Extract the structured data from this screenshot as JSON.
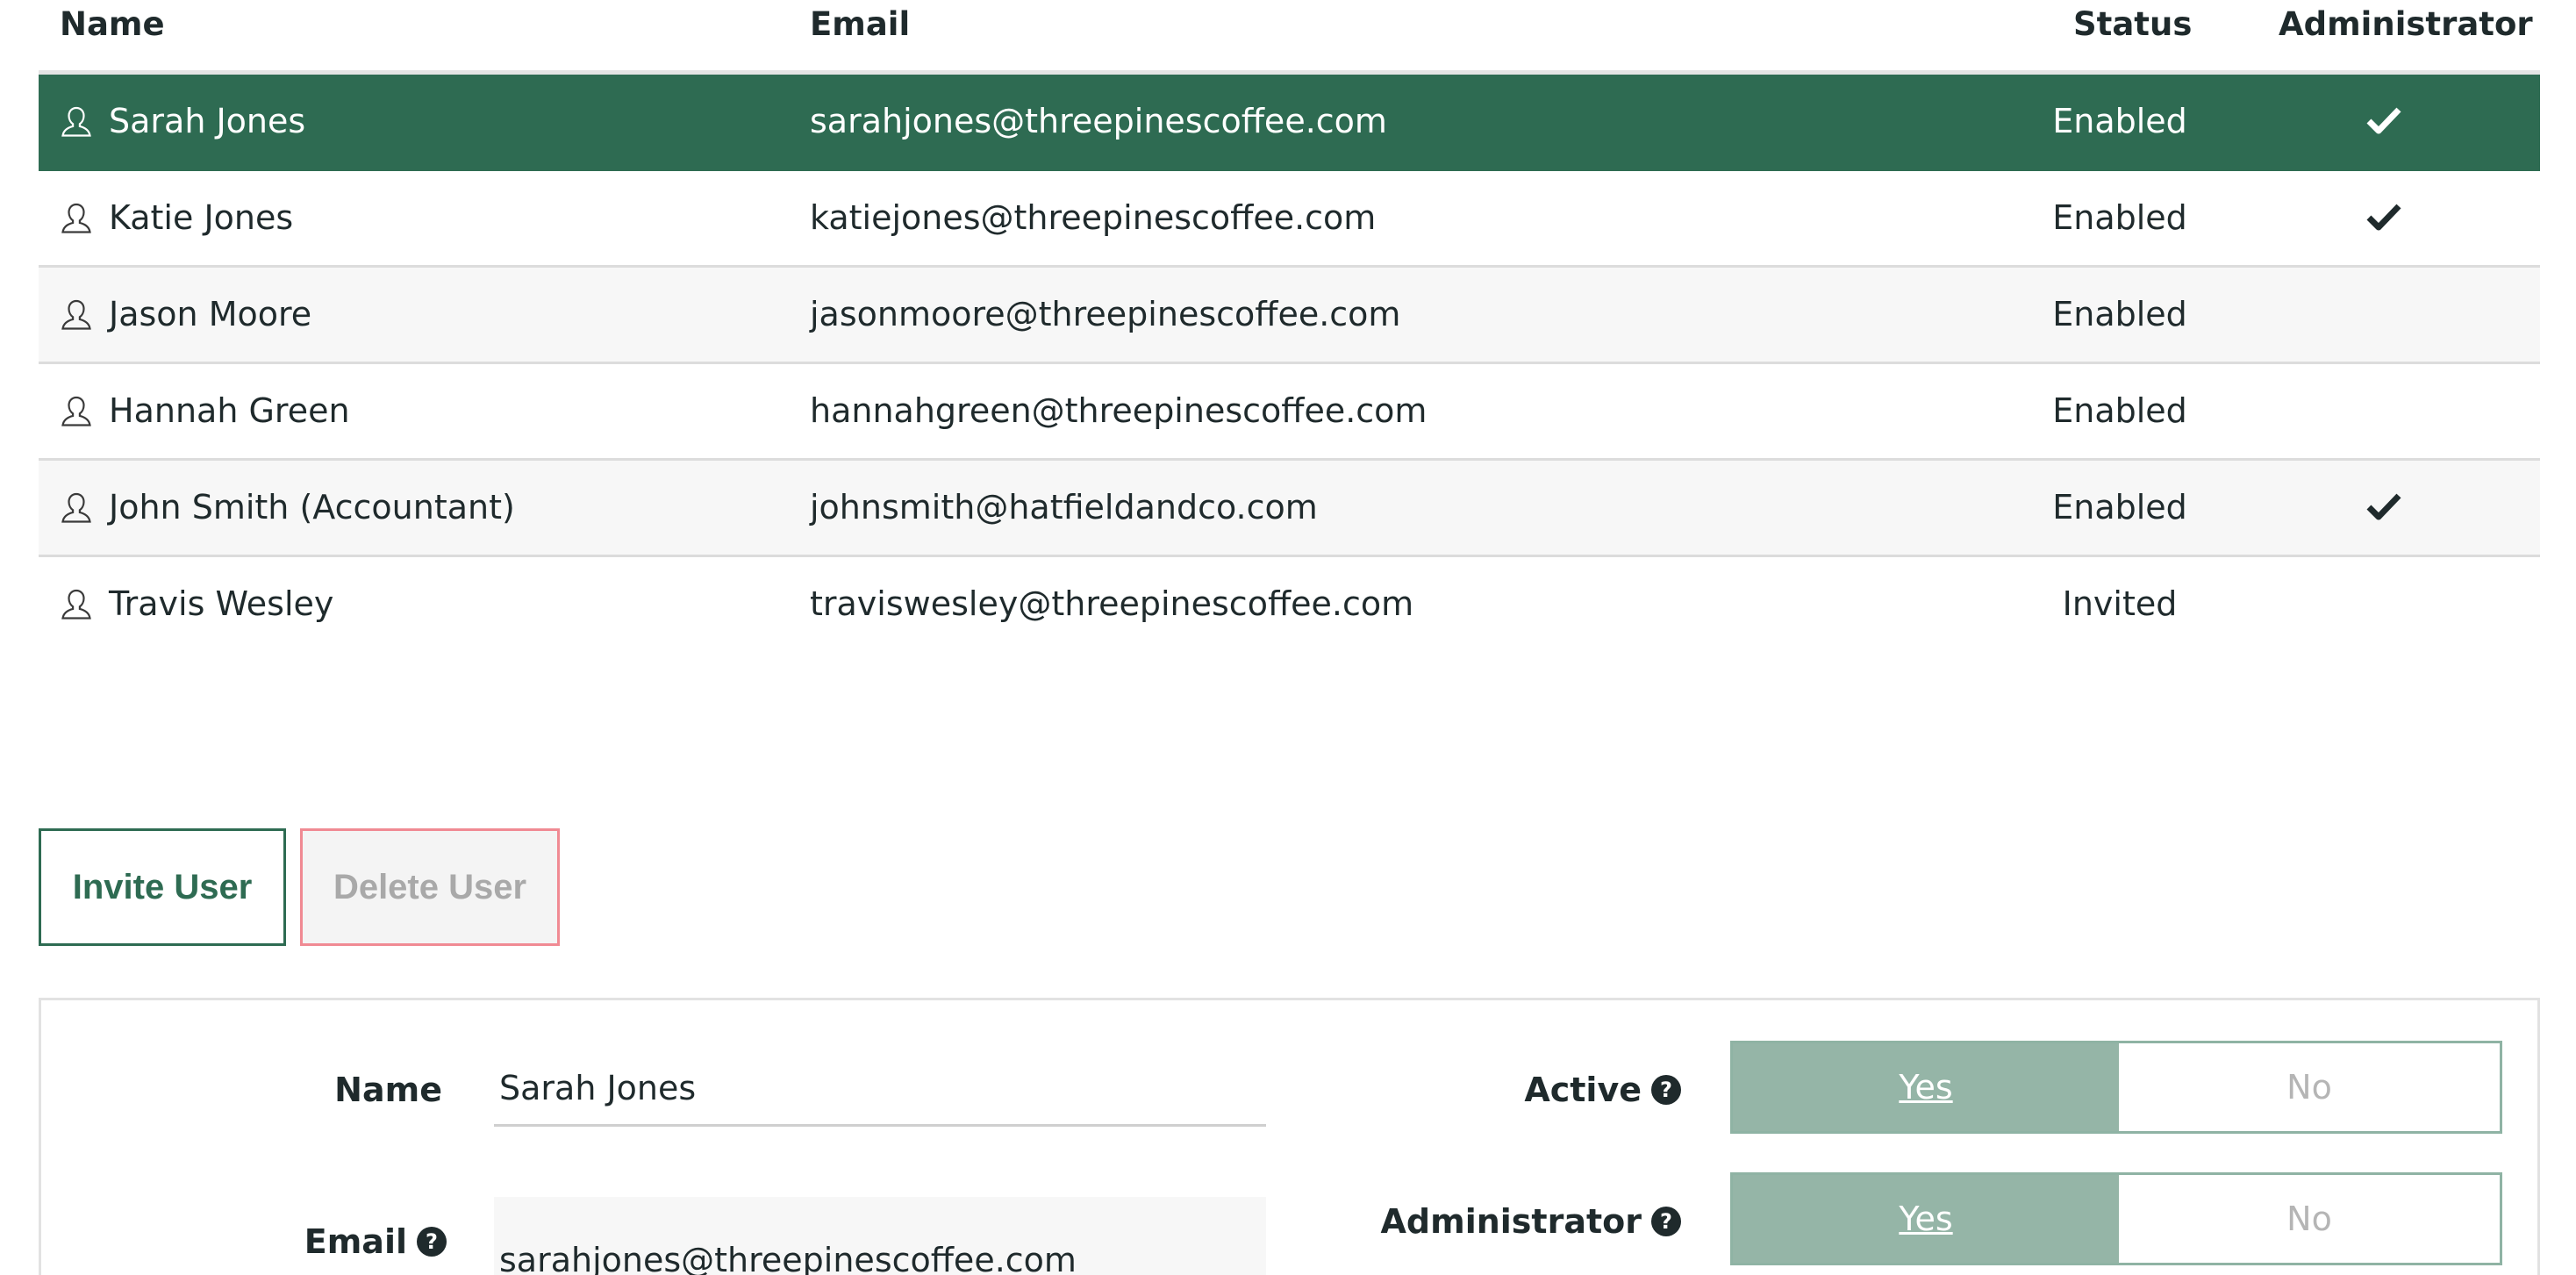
{
  "table": {
    "headers": {
      "name": "Name",
      "email": "Email",
      "status": "Status",
      "administrator": "Administrator"
    },
    "rows": [
      {
        "name": "Sarah Jones",
        "email": "sarahjones@threepinescoffee.com",
        "status": "Enabled",
        "admin": true,
        "selected": true
      },
      {
        "name": "Katie Jones",
        "email": "katiejones@threepinescoffee.com",
        "status": "Enabled",
        "admin": true,
        "selected": false
      },
      {
        "name": "Jason Moore",
        "email": "jasonmoore@threepinescoffee.com",
        "status": "Enabled",
        "admin": false,
        "selected": false
      },
      {
        "name": "Hannah Green",
        "email": "hannahgreen@threepinescoffee.com",
        "status": "Enabled",
        "admin": false,
        "selected": false
      },
      {
        "name": "John Smith (Accountant)",
        "email": "johnsmith@hatfieldandco.com",
        "status": "Enabled",
        "admin": true,
        "selected": false
      },
      {
        "name": "Travis Wesley",
        "email": "traviswesley@threepinescoffee.com",
        "status": "Invited",
        "admin": false,
        "selected": false
      }
    ]
  },
  "actions": {
    "invite_label": "Invite User",
    "delete_label": "Delete User"
  },
  "details": {
    "name_label": "Name",
    "name_value": "Sarah Jones",
    "email_label": "Email",
    "email_value": "sarahjones@threepinescoffee.com",
    "active_label": "Active",
    "active_value": "Yes",
    "administrator_label": "Administrator",
    "administrator_value": "Yes",
    "yes_label": "Yes",
    "no_label": "No"
  },
  "icons": {
    "user": "user-icon",
    "check": "check-icon",
    "help": "help-icon"
  },
  "colors": {
    "primary": "#2e6b52",
    "toggle_selected": "#95b5a7",
    "delete_border": "#f08a93",
    "row_alt": "#f7f7f7"
  }
}
